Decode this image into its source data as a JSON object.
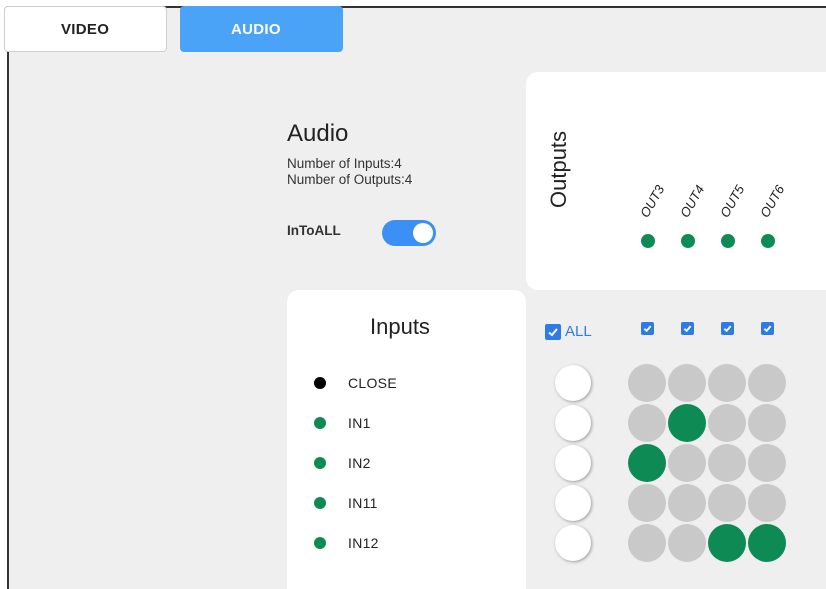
{
  "tabs": [
    {
      "label": "VIDEO",
      "active": false
    },
    {
      "label": "AUDIO",
      "active": true
    }
  ],
  "audio": {
    "title": "Audio",
    "num_inputs_text": "Number of Inputs:4",
    "num_outputs_text": "Number of Outputs:4",
    "intoall_label": "InToALL",
    "intoall_on": true
  },
  "outputs": {
    "title": "Outputs",
    "labels": [
      "OUT3",
      "OUT4",
      "OUT5",
      "OUT6"
    ]
  },
  "inputs": {
    "title": "Inputs",
    "items": [
      {
        "label": "CLOSE",
        "color": "#000000"
      },
      {
        "label": "IN1",
        "color": "#0e8a55"
      },
      {
        "label": "IN2",
        "color": "#0e8a55"
      },
      {
        "label": "IN11",
        "color": "#0e8a55"
      },
      {
        "label": "IN12",
        "color": "#0e8a55"
      }
    ]
  },
  "matrix": {
    "all_label": "ALL",
    "all_checked": true,
    "column_checked": [
      true,
      true,
      true,
      true
    ],
    "routes": [
      [
        0,
        0,
        0,
        0
      ],
      [
        0,
        1,
        0,
        0
      ],
      [
        1,
        0,
        0,
        0
      ],
      [
        0,
        0,
        0,
        0
      ],
      [
        0,
        0,
        1,
        1
      ]
    ]
  },
  "colors": {
    "accent": "#4aa3f7",
    "active_route": "#0e8a55",
    "inactive_route": "#c9c9c9",
    "checkbox": "#2e7be6"
  },
  "icons": {
    "toggle": "toggle-switch",
    "checkbox": "checkbox-checked-icon",
    "status": "status-dot-icon"
  }
}
